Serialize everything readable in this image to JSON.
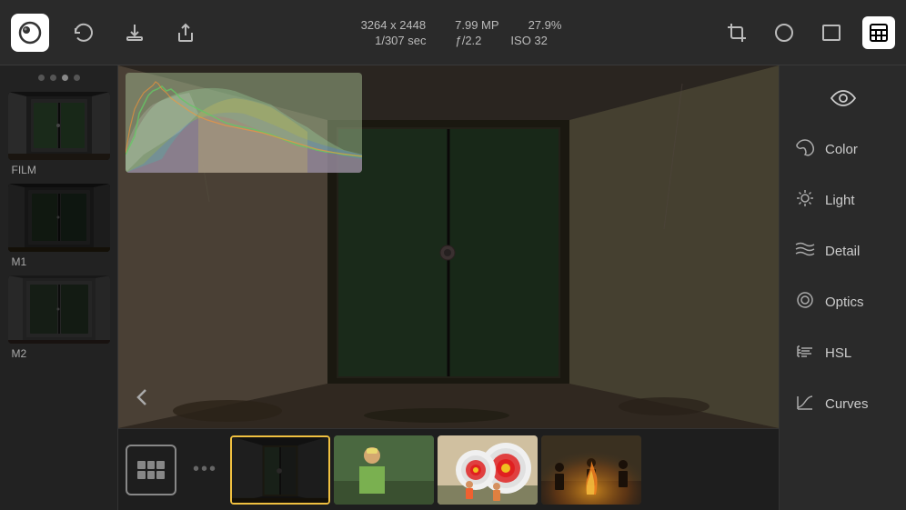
{
  "toolbar": {
    "app_icon": "👁",
    "meta": {
      "dimensions": "3264 x 2448",
      "megapixels": "7.99 MP",
      "zoom": "27.9%",
      "shutter": "1/307 sec",
      "aperture": "ƒ/2.2",
      "iso": "ISO 32"
    },
    "icons": {
      "history": "↺",
      "download": "⬇",
      "share": "⬆",
      "crop": "✂",
      "circle": "○",
      "aspect": "⬜",
      "active_tool": "⊠"
    }
  },
  "presets": {
    "dots": [
      false,
      false,
      true,
      false
    ],
    "items": [
      {
        "label": "FILM"
      },
      {
        "label": "M1"
      },
      {
        "label": "M2"
      }
    ]
  },
  "right_panel": {
    "items": [
      {
        "id": "eye",
        "icon": "👁",
        "label": ""
      },
      {
        "id": "color",
        "icon": "🎨",
        "label": "Color"
      },
      {
        "id": "light",
        "icon": "☀",
        "label": "Light"
      },
      {
        "id": "detail",
        "icon": "≋",
        "label": "Detail"
      },
      {
        "id": "optics",
        "icon": "◎",
        "label": "Optics"
      },
      {
        "id": "hsl",
        "icon": "𝄢",
        "label": "HSL"
      },
      {
        "id": "curves",
        "icon": "↗",
        "label": "Curves"
      }
    ]
  },
  "filmstrip": {
    "dots_label": "•••",
    "thumbs": [
      {
        "id": "door",
        "selected": true,
        "label": "door"
      },
      {
        "id": "person",
        "selected": false,
        "label": "person"
      },
      {
        "id": "archery",
        "selected": false,
        "label": "archery"
      },
      {
        "id": "group",
        "selected": false,
        "label": "group"
      }
    ]
  }
}
